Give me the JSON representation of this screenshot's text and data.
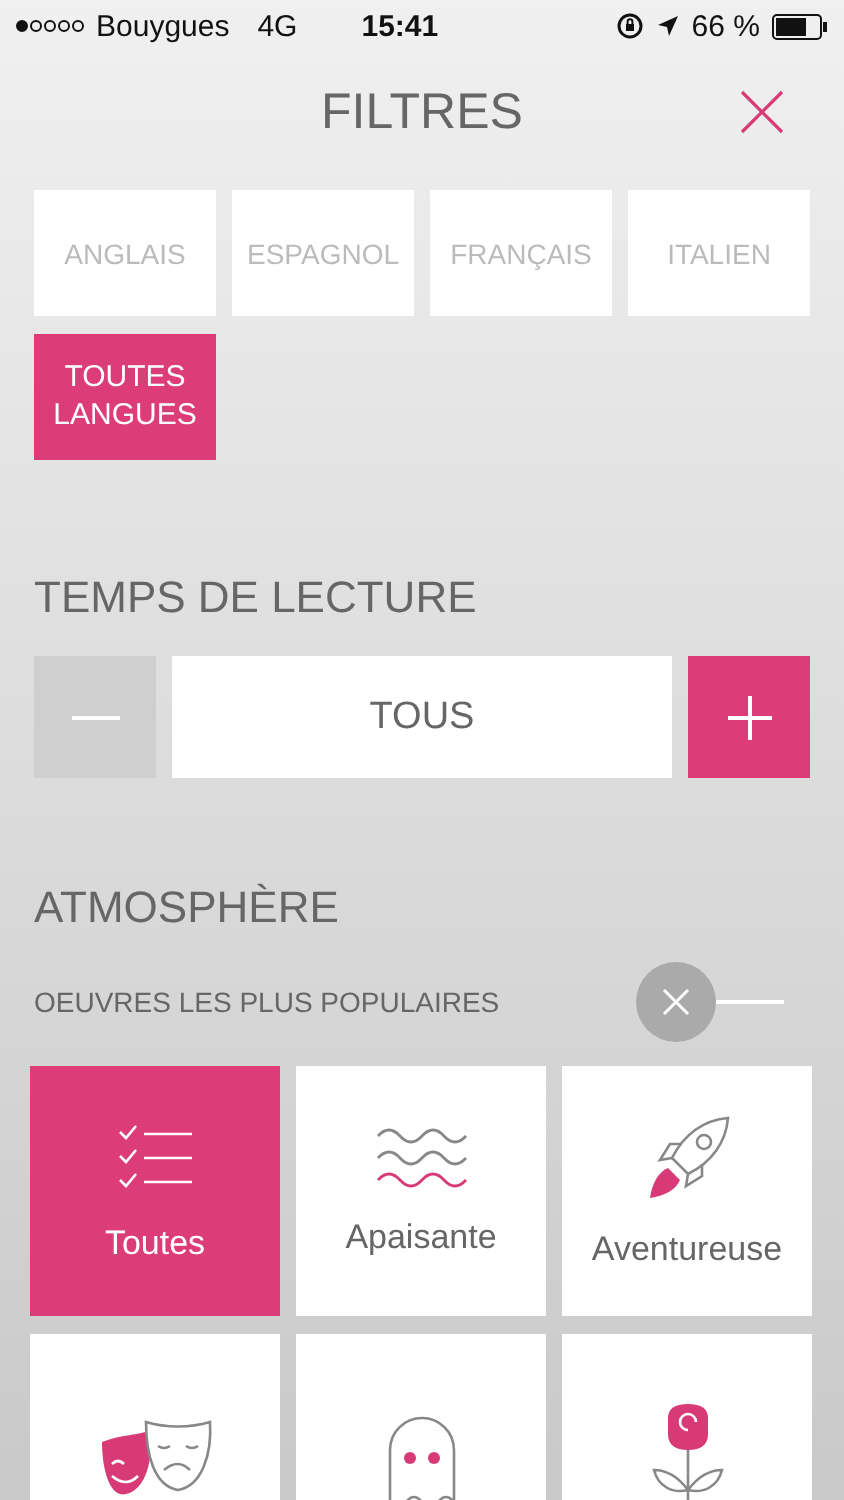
{
  "status_bar": {
    "carrier": "Bouygues",
    "network": "4G",
    "time": "15:41",
    "battery": "66 %"
  },
  "header": {
    "title": "FILTRES"
  },
  "languages": [
    {
      "label": "ANGLAIS",
      "selected": false
    },
    {
      "label": "ESPAGNOL",
      "selected": false
    },
    {
      "label": "FRANÇAIS",
      "selected": false
    },
    {
      "label": "ITALIEN",
      "selected": false
    },
    {
      "label": "TOUTES LANGUES",
      "selected": true
    }
  ],
  "reading_time": {
    "title": "TEMPS DE LECTURE",
    "value": "TOUS"
  },
  "atmosphere": {
    "title": "ATMOSPHÈRE",
    "popular_label": "OEUVRES LES PLUS POPULAIRES",
    "popular_on": false,
    "tiles": [
      {
        "kind": "list",
        "label": "Toutes",
        "selected": true
      },
      {
        "kind": "waves",
        "label": "Apaisante",
        "selected": false
      },
      {
        "kind": "rocket",
        "label": "Aventureuse",
        "selected": false
      },
      {
        "kind": "masks",
        "selected": false
      },
      {
        "kind": "ghost",
        "selected": false
      },
      {
        "kind": "rose",
        "selected": false
      }
    ]
  }
}
